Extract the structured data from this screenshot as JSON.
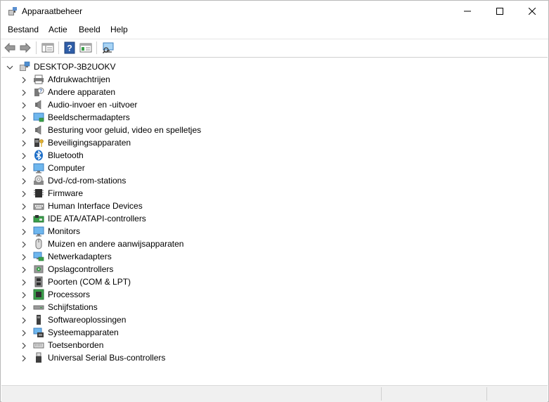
{
  "window": {
    "title": "Apparaatbeheer"
  },
  "menu": {
    "items": [
      "Bestand",
      "Actie",
      "Beeld",
      "Help"
    ]
  },
  "toolbar": {
    "buttons": [
      "back-icon",
      "forward-icon",
      "show-hide-console-tree-icon",
      "help-icon",
      "properties-icon",
      "scan-hardware-icon"
    ]
  },
  "tree": {
    "root": "DESKTOP-3B2UOKV",
    "categories": [
      {
        "label": "Afdrukwachtrijen",
        "icon": "printer-icon"
      },
      {
        "label": "Andere apparaten",
        "icon": "unknown-device-icon"
      },
      {
        "label": "Audio-invoer en -uitvoer",
        "icon": "speaker-icon"
      },
      {
        "label": "Beeldschermadapters",
        "icon": "display-adapter-icon"
      },
      {
        "label": "Besturing voor geluid, video en spelletjes",
        "icon": "speaker-icon"
      },
      {
        "label": "Beveiligingsapparaten",
        "icon": "security-key-icon"
      },
      {
        "label": "Bluetooth",
        "icon": "bluetooth-icon"
      },
      {
        "label": "Computer",
        "icon": "computer-icon"
      },
      {
        "label": "Dvd-/cd-rom-stations",
        "icon": "disc-drive-icon"
      },
      {
        "label": "Firmware",
        "icon": "firmware-chip-icon"
      },
      {
        "label": "Human Interface Devices",
        "icon": "hid-icon"
      },
      {
        "label": "IDE ATA/ATAPI-controllers",
        "icon": "ide-controller-icon"
      },
      {
        "label": "Monitors",
        "icon": "monitor-icon"
      },
      {
        "label": "Muizen en andere aanwijsapparaten",
        "icon": "mouse-icon"
      },
      {
        "label": "Netwerkadapters",
        "icon": "network-adapter-icon"
      },
      {
        "label": "Opslagcontrollers",
        "icon": "storage-controller-icon"
      },
      {
        "label": "Poorten (COM & LPT)",
        "icon": "port-icon"
      },
      {
        "label": "Processors",
        "icon": "processor-icon"
      },
      {
        "label": "Schijfstations",
        "icon": "disk-drive-icon"
      },
      {
        "label": "Softwareoplossingen",
        "icon": "software-component-icon"
      },
      {
        "label": "Systeemapparaten",
        "icon": "system-device-icon"
      },
      {
        "label": "Toetsenborden",
        "icon": "keyboard-icon"
      },
      {
        "label": "Universal Serial Bus-controllers",
        "icon": "usb-icon"
      }
    ]
  },
  "colors": {
    "accent": "#1e6fc8",
    "icon_gray": "#6b6b6b"
  }
}
